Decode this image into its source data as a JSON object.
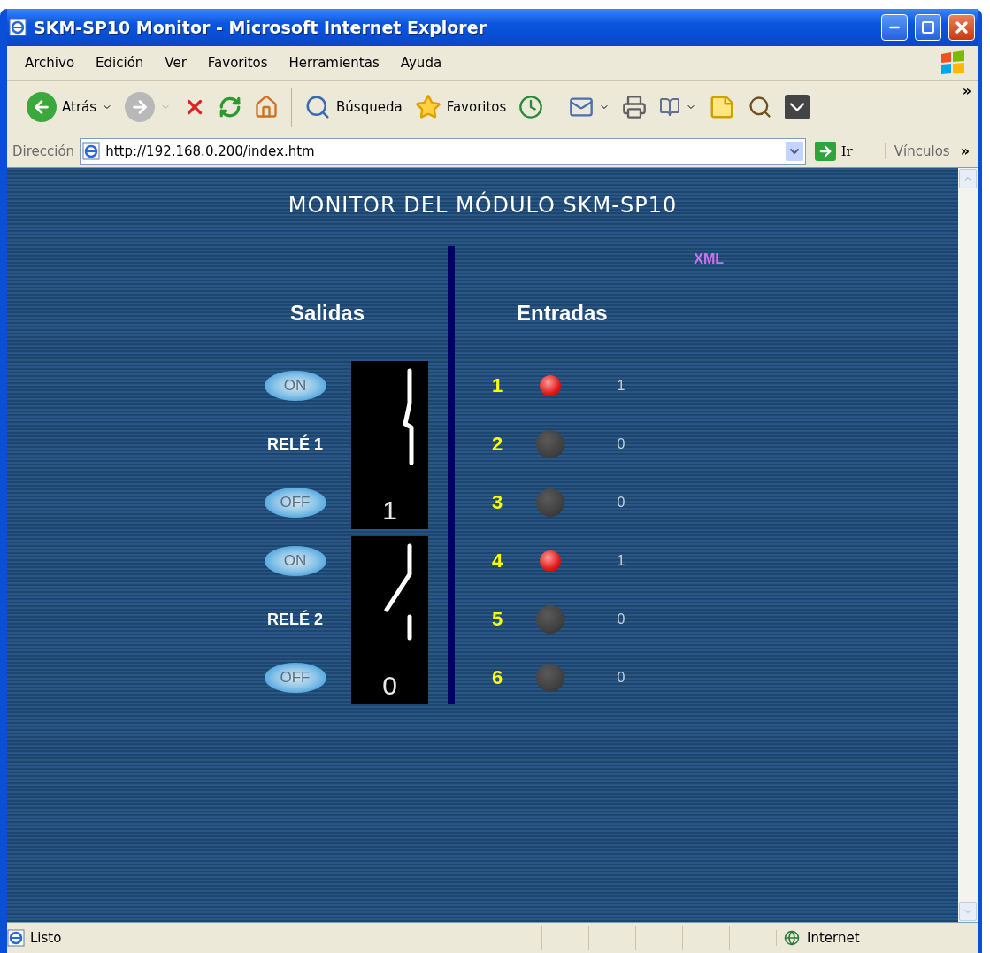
{
  "window": {
    "title": "SKM-SP10 Monitor - Microsoft Internet Explorer"
  },
  "menu": [
    "Archivo",
    "Edición",
    "Ver",
    "Favoritos",
    "Herramientas",
    "Ayuda"
  ],
  "toolbar": {
    "back": "Atrás",
    "search": "Búsqueda",
    "favorites": "Favoritos",
    "more": "»"
  },
  "address": {
    "label": "Dirección",
    "value": "http://192.168.0.200/index.htm",
    "go": "Ir",
    "links": "Vínculos",
    "more": "»"
  },
  "page": {
    "title": "MONITOR DEL MÓDULO SKM-SP10",
    "xml_link": "XML",
    "outputs_heading": "Salidas",
    "relays": [
      {
        "on_label": "ON",
        "name": "RELÉ 1",
        "off_label": "OFF",
        "state": "1",
        "closed": true
      },
      {
        "on_label": "ON",
        "name": "RELÉ 2",
        "off_label": "OFF",
        "state": "0",
        "closed": false
      }
    ],
    "inputs_heading": "Entradas",
    "inputs": [
      {
        "number": "1",
        "on": true,
        "value": "1"
      },
      {
        "number": "2",
        "on": false,
        "value": "0"
      },
      {
        "number": "3",
        "on": false,
        "value": "0"
      },
      {
        "number": "4",
        "on": true,
        "value": "1"
      },
      {
        "number": "5",
        "on": false,
        "value": "0"
      },
      {
        "number": "6",
        "on": false,
        "value": "0"
      }
    ]
  },
  "status_bar": {
    "text": "Listo",
    "zone": "Internet"
  }
}
